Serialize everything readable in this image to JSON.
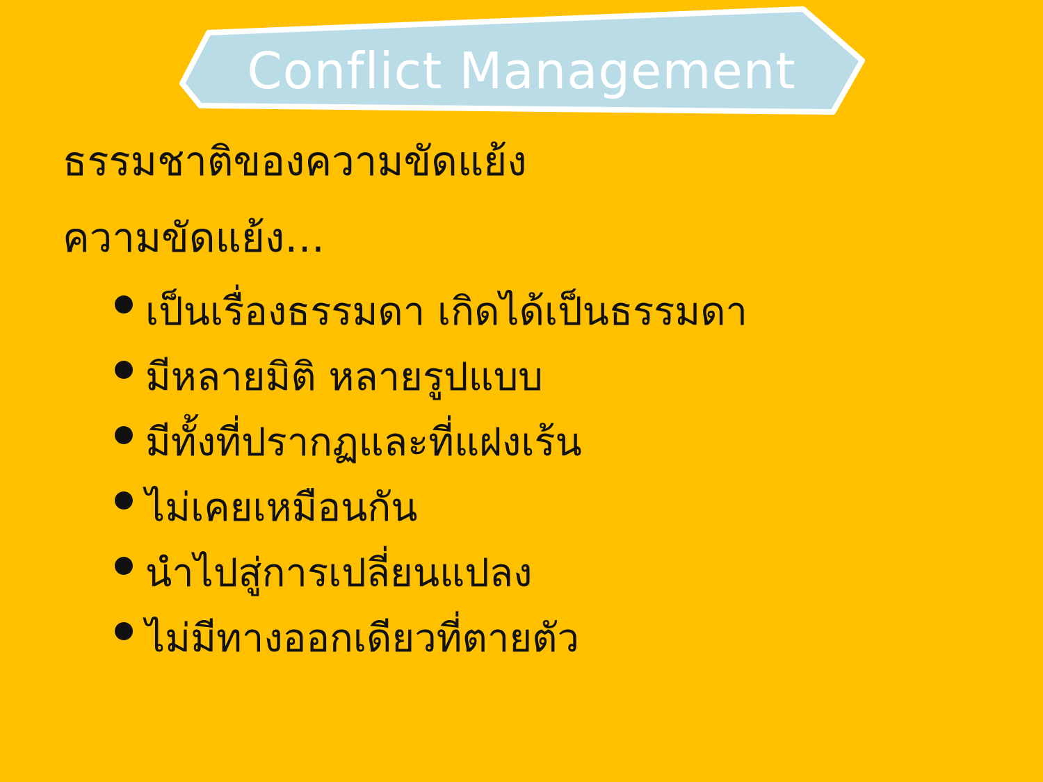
{
  "slide": {
    "title": "Conflict Management",
    "heading": "ธรรมชาติของความขัดแย้ง",
    "subheading": "ความขัดแย้ง…",
    "bullets": [
      "เป็นเรื่องธรรมดา เกิดได้เป็นธรรมดา",
      "มีหลายมิติ หลายรูปแบบ",
      "มีทั้งที่ปรากฏและที่แฝงเร้น",
      "ไม่เคยเหมือนกัน",
      "นำไปสู่การเปลี่ยนแปลง",
      "ไม่มีทางออกเดียวที่ตายตัว"
    ]
  },
  "colors": {
    "background": "#FFC000",
    "banner_fill": "#B9DCE7",
    "banner_outline": "#FFFFFF",
    "title_text": "#FFFFFF",
    "body_text": "#111111"
  }
}
